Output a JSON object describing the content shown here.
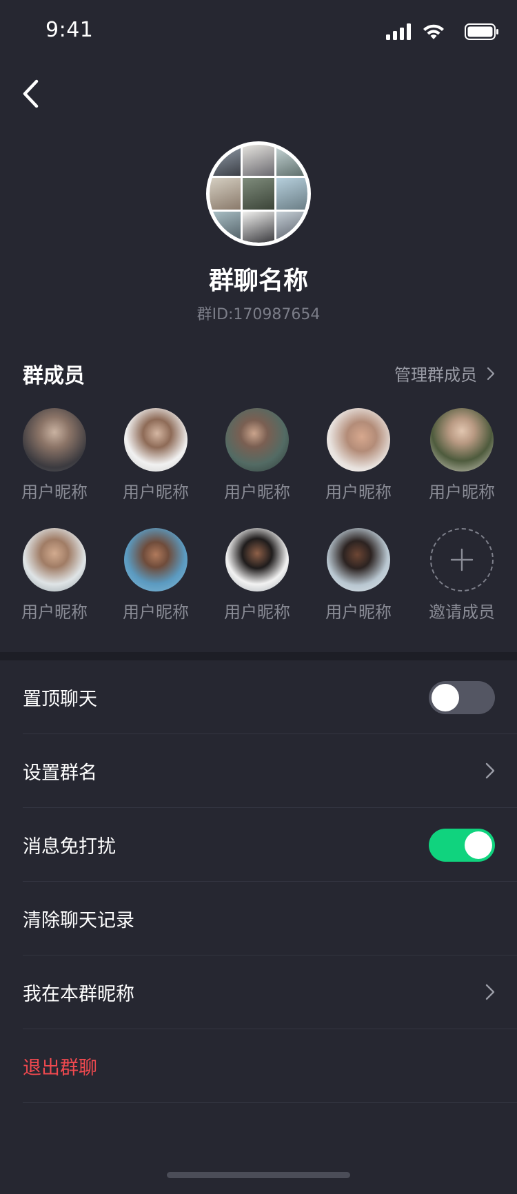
{
  "status_bar": {
    "time": "9:41"
  },
  "header": {
    "group_name": "群聊名称",
    "group_id": "群ID:170987654"
  },
  "members_section": {
    "title": "群成员",
    "manage_label": "管理群成员",
    "members": [
      {
        "name": "用户昵称"
      },
      {
        "name": "用户昵称"
      },
      {
        "name": "用户昵称"
      },
      {
        "name": "用户昵称"
      },
      {
        "name": "用户昵称"
      },
      {
        "name": "用户昵称"
      },
      {
        "name": "用户昵称"
      },
      {
        "name": "用户昵称"
      },
      {
        "name": "用户昵称"
      }
    ],
    "invite_label": "邀请成员"
  },
  "settings": {
    "pin_chat": {
      "label": "置顶聊天",
      "enabled": false
    },
    "set_group_name": {
      "label": "设置群名"
    },
    "do_not_disturb": {
      "label": "消息免打扰",
      "enabled": true
    },
    "clear_history": {
      "label": "清除聊天记录"
    },
    "my_nickname": {
      "label": "我在本群昵称"
    },
    "leave_group": {
      "label": "退出群聊"
    }
  },
  "colors": {
    "background": "#262731",
    "accent_green": "#10d37e",
    "danger_red": "#f0494f"
  }
}
